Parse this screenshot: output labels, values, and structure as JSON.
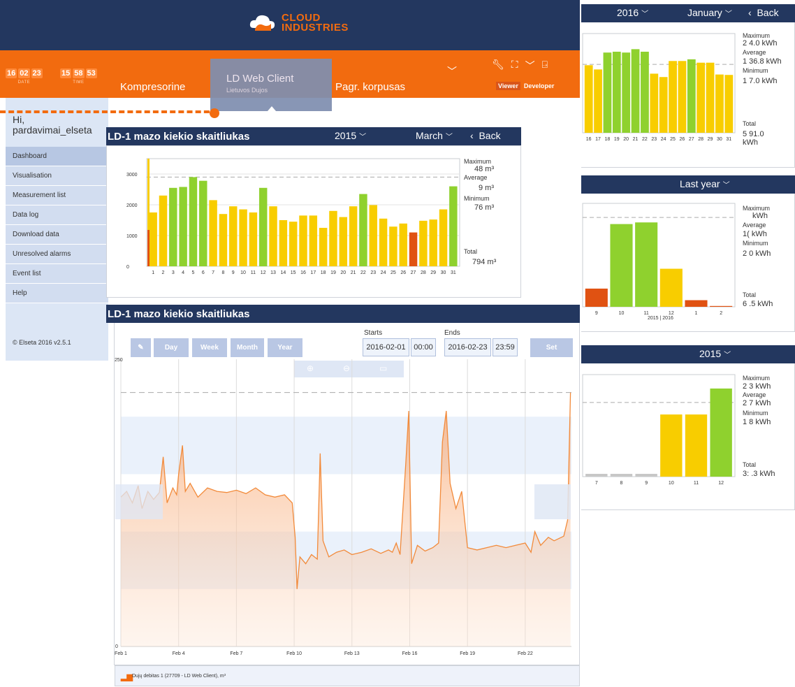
{
  "header": {
    "logo_top": "CLOUD",
    "logo_bottom": "INDUSTRIES",
    "colors": {
      "navy": "#23375f",
      "orange": "#f26b0f",
      "green": "#8fd12e",
      "yellow": "#f8cd00",
      "red": "#e05212",
      "light_blue": "#dce6f5"
    }
  },
  "clock": {
    "date_digits": [
      "16",
      "02",
      "23"
    ],
    "date_label": "DATE",
    "time_digits": [
      "15",
      "58",
      "53"
    ],
    "time_label": "TIME"
  },
  "nav": {
    "items": [
      {
        "label": "Kompresorine"
      },
      {
        "label": "LD Web Client",
        "sub": "Lietuvos Dujos"
      },
      {
        "label": "Pagr. korpusas"
      }
    ],
    "icons": [
      "wrench-icon",
      "map-icon",
      "chevron-down-icon",
      "logout-icon"
    ],
    "role_viewer": "Viewer",
    "role_developer": "Developer"
  },
  "sidebar": {
    "greeting": "Hi,",
    "username": "pardavimai_elseta",
    "items": [
      "Dashboard",
      "Visualisation",
      "Measurement list",
      "Data log",
      "Download data",
      "Unresolved alarms",
      "Event list",
      "Help"
    ],
    "active_index": 0,
    "copyright": "© Elseta 2016 v2.5.1"
  },
  "daily_panel": {
    "title": "LD-1 mazo kiekio skaitliukas",
    "year": "2015",
    "month": "March",
    "back": "Back",
    "stats": {
      "max_label": "Maximum",
      "max_value": "48 m³",
      "avg_label": "Average",
      "avg_value": "9 m³",
      "min_label": "Minimum",
      "min_value": "76 m³",
      "total_label": "Total",
      "total_value": "794 m³"
    },
    "y_ticks": [
      "3000",
      "2000",
      "1000",
      "0"
    ],
    "chart_data": {
      "type": "bar",
      "categories": [
        "1",
        "2",
        "3",
        "4",
        "5",
        "6",
        "7",
        "8",
        "9",
        "10",
        "11",
        "12",
        "13",
        "14",
        "15",
        "16",
        "17",
        "18",
        "19",
        "20",
        "21",
        "22",
        "23",
        "24",
        "25",
        "26",
        "27",
        "28",
        "29",
        "30",
        "31"
      ],
      "values": [
        1750,
        2300,
        2550,
        2580,
        2900,
        2780,
        2150,
        1700,
        1950,
        1850,
        1750,
        2550,
        1950,
        1500,
        1450,
        1650,
        1650,
        1250,
        1800,
        1600,
        1950,
        2350,
        1990,
        1550,
        1290,
        1390,
        1100,
        1480,
        1520,
        1850,
        2600
      ],
      "colors": [
        "yellow",
        "yellow",
        "green",
        "green",
        "green",
        "green",
        "yellow",
        "yellow",
        "yellow",
        "yellow",
        "yellow",
        "green",
        "yellow",
        "yellow",
        "yellow",
        "yellow",
        "yellow",
        "yellow",
        "yellow",
        "yellow",
        "yellow",
        "green",
        "yellow",
        "yellow",
        "yellow",
        "yellow",
        "red",
        "yellow",
        "yellow",
        "yellow",
        "green"
      ],
      "ylim": [
        0,
        3500
      ],
      "average": 2900
    }
  },
  "jan_panel": {
    "year": "2016",
    "month": "January",
    "back": "Back",
    "stats": {
      "max_label": "Maximum",
      "max_value": "2  4.0 kWh",
      "avg_label": "Average",
      "avg_value": "1  36.8 kWh",
      "min_label": "Minimum",
      "min_value": "1  7.0 kWh",
      "total_label": "Total",
      "total_value": "5  91.0",
      "total_unit": "kWh"
    },
    "chart_data": {
      "type": "bar",
      "categories": [
        "16",
        "17",
        "18",
        "19",
        "20",
        "21",
        "22",
        "23",
        "24",
        "25",
        "26",
        "27",
        "28",
        "29",
        "30",
        "31"
      ],
      "values": [
        1600,
        1500,
        1900,
        1920,
        1900,
        1980,
        1920,
        1400,
        1320,
        1700,
        1700,
        1740,
        1660,
        1660,
        1380,
        1370
      ],
      "colors": [
        "yellow",
        "yellow",
        "green",
        "green",
        "green",
        "green",
        "green",
        "yellow",
        "yellow",
        "yellow",
        "yellow",
        "green",
        "yellow",
        "yellow",
        "yellow",
        "yellow"
      ],
      "ylim": [
        0,
        2350
      ],
      "average": 1620
    }
  },
  "year_panel": {
    "selector": "Last year",
    "stats": {
      "max_label": "Maximum",
      "max_value": "kWh",
      "avg_label": "Average",
      "avg_value": "1(    kWh",
      "min_label": "Minimum",
      "min_value": "2   0 kWh",
      "total_label": "Total",
      "total_value": "6   .5 kWh"
    },
    "x_sub": "2015 | 2016",
    "chart_data": {
      "type": "bar",
      "categories": [
        "9",
        "10",
        "11",
        "12",
        "1",
        "2"
      ],
      "values": [
        22,
        100,
        102,
        46,
        8,
        1
      ],
      "colors": [
        "red",
        "green",
        "green",
        "yellow",
        "red",
        "red"
      ],
      "ylim": [
        0,
        125
      ],
      "average": 108
    }
  },
  "months_panel": {
    "year": "2015",
    "stats": {
      "max_label": "Maximum",
      "max_value": "2   3 kWh",
      "avg_label": "Average",
      "avg_value": "2   7 kWh",
      "min_label": "Minimum",
      "min_value": "1   8 kWh",
      "total_label": "Total",
      "total_value": "3:    .3 kWh"
    },
    "chart_data": {
      "type": "bar",
      "categories": [
        "7",
        "8",
        "9",
        "10",
        "11",
        "12"
      ],
      "values": [
        3,
        3,
        3,
        67,
        67,
        95
      ],
      "colors": [
        "gray",
        "gray",
        "gray",
        "yellow",
        "yellow",
        "green"
      ],
      "ylim": [
        0,
        110
      ],
      "average": 80
    }
  },
  "main_panel": {
    "title": "LD-1 mazo kiekio skaitliukas",
    "buttons": {
      "day": "Day",
      "week": "Week",
      "month": "Month",
      "year": "Year",
      "set": "Set"
    },
    "starts_label": "Starts",
    "start_date": "2016-02-01",
    "start_time": "00:00",
    "ends_label": "Ends",
    "end_date": "2016-02-23",
    "end_time": "23:59",
    "y_top_label": "250",
    "y_zero_label": "0",
    "legend": "Dujų debitas 1 (27709 - LD Web Client), m³",
    "chart_data": {
      "type": "area",
      "x_labels": [
        "Feb 1",
        "Feb 4",
        "Feb 7",
        "Feb 10",
        "Feb 13",
        "Feb 16",
        "Feb 19",
        "Feb 22"
      ],
      "x_tick_days": [
        1,
        4,
        7,
        10,
        13,
        16,
        19,
        22
      ],
      "xlim_days": [
        1,
        24.4
      ],
      "ylim": [
        0,
        250
      ],
      "dashed_max": 221,
      "points": [
        [
          1,
          130
        ],
        [
          1.3,
          135
        ],
        [
          1.6,
          125
        ],
        [
          1.9,
          140
        ],
        [
          2.1,
          120
        ],
        [
          2.4,
          135
        ],
        [
          2.7,
          128
        ],
        [
          3,
          134
        ],
        [
          3.2,
          165
        ],
        [
          3.4,
          125
        ],
        [
          3.7,
          138
        ],
        [
          3.9,
          132
        ],
        [
          4,
          150
        ],
        [
          4.2,
          175
        ],
        [
          4.35,
          135
        ],
        [
          4.6,
          142
        ],
        [
          5,
          130
        ],
        [
          5.5,
          138
        ],
        [
          6,
          135
        ],
        [
          6.5,
          134
        ],
        [
          7,
          136
        ],
        [
          7.5,
          133
        ],
        [
          8,
          138
        ],
        [
          8.5,
          132
        ],
        [
          9,
          130
        ],
        [
          9.5,
          132
        ],
        [
          9.9,
          125
        ],
        [
          10.05,
          95
        ],
        [
          10.15,
          50
        ],
        [
          10.3,
          78
        ],
        [
          10.6,
          72
        ],
        [
          10.9,
          80
        ],
        [
          11.2,
          76
        ],
        [
          11.35,
          168
        ],
        [
          11.5,
          92
        ],
        [
          11.8,
          78
        ],
        [
          12.2,
          82
        ],
        [
          12.6,
          84
        ],
        [
          13,
          80
        ],
        [
          13.5,
          82
        ],
        [
          14,
          85
        ],
        [
          14.5,
          81
        ],
        [
          14.9,
          84
        ],
        [
          15.1,
          82
        ],
        [
          15.3,
          90
        ],
        [
          15.5,
          80
        ],
        [
          15.8,
          160
        ],
        [
          15.95,
          205
        ],
        [
          16.1,
          72
        ],
        [
          16.4,
          88
        ],
        [
          16.8,
          83
        ],
        [
          17.2,
          86
        ],
        [
          17.5,
          90
        ],
        [
          17.7,
          178
        ],
        [
          17.9,
          205
        ],
        [
          18.1,
          142
        ],
        [
          18.4,
          120
        ],
        [
          18.7,
          135
        ],
        [
          19,
          86
        ],
        [
          19.5,
          84
        ],
        [
          20,
          86
        ],
        [
          20.5,
          88
        ],
        [
          21,
          86
        ],
        [
          21.5,
          88
        ],
        [
          22,
          90
        ],
        [
          22.3,
          82
        ],
        [
          22.5,
          100
        ],
        [
          22.8,
          88
        ],
        [
          23.2,
          95
        ],
        [
          23.5,
          92
        ],
        [
          24,
          96
        ],
        [
          24.2,
          110
        ],
        [
          24.35,
          221
        ]
      ]
    }
  }
}
